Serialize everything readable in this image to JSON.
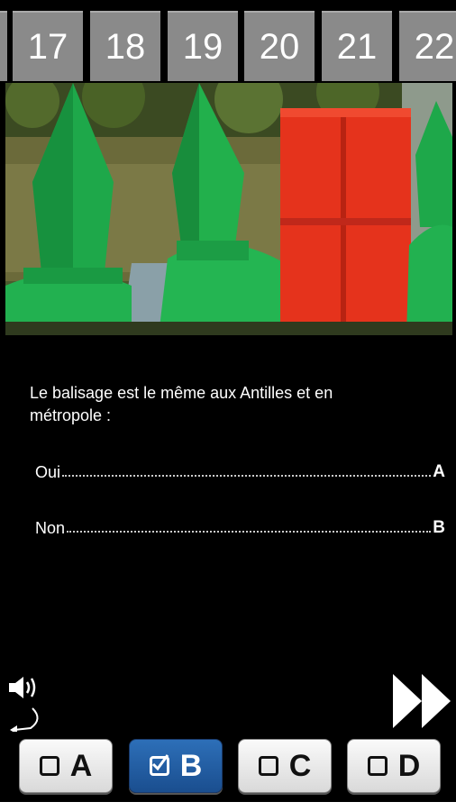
{
  "question_numbers": [
    "17",
    "18",
    "19",
    "20",
    "21",
    "22"
  ],
  "question": {
    "text": "Le balisage est le même aux Antilles et en métropole :"
  },
  "answers": [
    {
      "label": "Oui",
      "letter": "A"
    },
    {
      "label": "Non",
      "letter": "B"
    }
  ],
  "answer_buttons": [
    {
      "letter": "A",
      "checked": false
    },
    {
      "letter": "B",
      "checked": true
    },
    {
      "letter": "C",
      "checked": false
    },
    {
      "letter": "D",
      "checked": false
    }
  ],
  "icons": {
    "audio": "speaker-icon",
    "replay": "replay-arrow-icon",
    "next": "fast-forward-icon"
  },
  "colors": {
    "tab_bg": "#8a8a8a",
    "selected_button": "#1f5ba3",
    "buoy_green": "#1ea84a",
    "buoy_red": "#e5331c"
  }
}
